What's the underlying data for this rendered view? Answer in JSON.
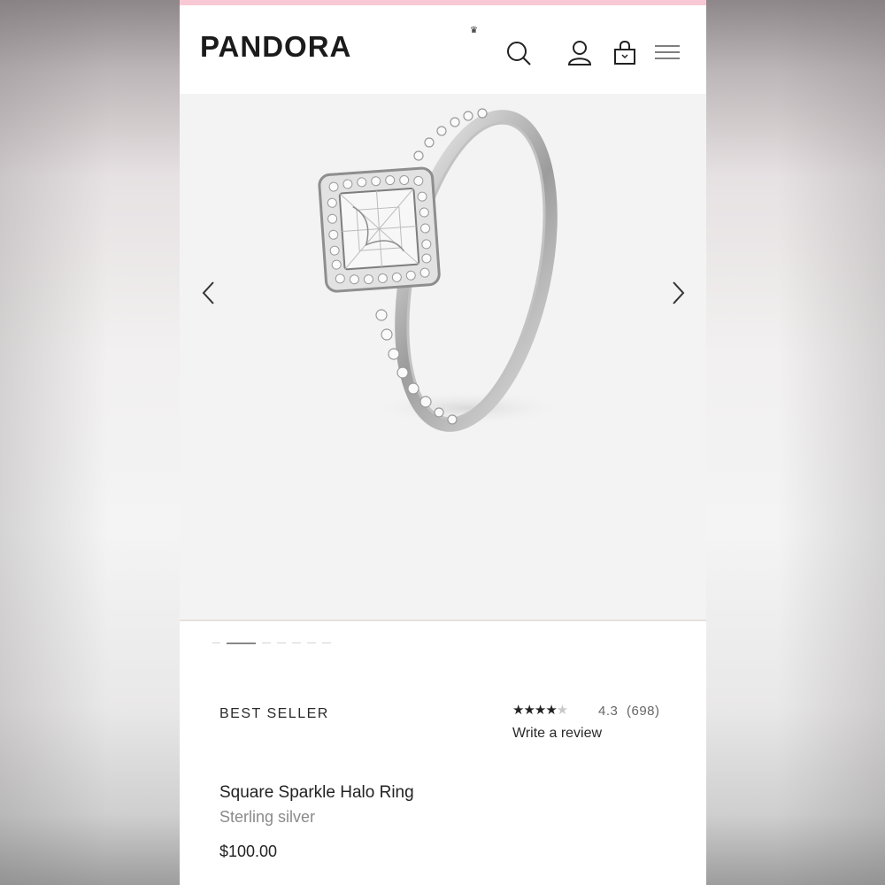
{
  "header": {
    "logo": "PANDORA",
    "icons": [
      "search-icon",
      "account-icon",
      "bag-icon",
      "menu-icon"
    ]
  },
  "gallery": {
    "image_alt": "Square Sparkle Halo Ring",
    "slide_count": 7,
    "active_slide": 2
  },
  "product": {
    "badge": "BEST SELLER",
    "stars": "★★★★",
    "star_empty": "★",
    "rating": "4.3",
    "review_count": "(698)",
    "review_link": "Write a review",
    "name": "Square Sparkle Halo Ring",
    "material": "Sterling silver",
    "price": "$100.00"
  },
  "colors": {
    "accent_bar": "#f8c9d4",
    "gallery_bg": "#f3f3f3",
    "text": "#222222",
    "muted": "#8a8a8a"
  }
}
